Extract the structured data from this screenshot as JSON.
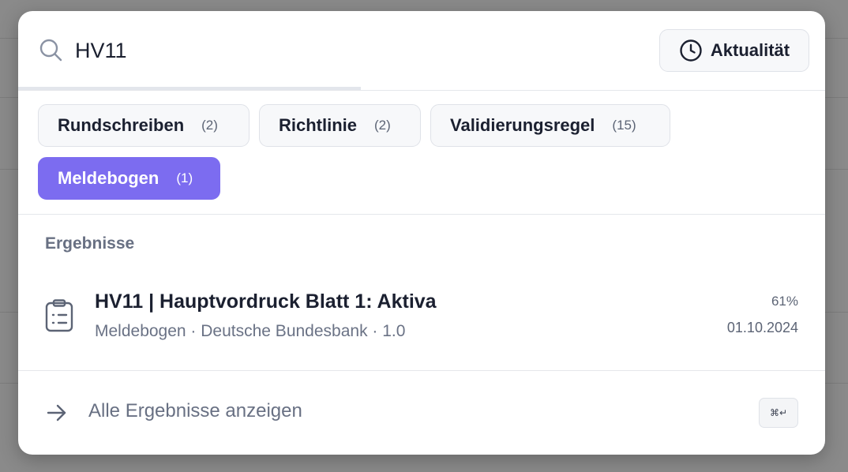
{
  "search": {
    "query": "HV11",
    "placeholder": "",
    "progress": 0.425
  },
  "sort_button": {
    "label": "Aktualität",
    "icon": "clock-icon"
  },
  "filters": [
    {
      "label": "Rundschreiben",
      "count": "(2)",
      "active": false
    },
    {
      "label": "Richtlinie",
      "count": "(2)",
      "active": false
    },
    {
      "label": "Validierungsregel",
      "count": "(15)",
      "active": false
    },
    {
      "label": "Meldebogen",
      "count": "(1)",
      "active": true
    }
  ],
  "results": {
    "section_label": "Ergebnisse",
    "items": [
      {
        "title": "HV11 | Hauptvordruck Blatt 1: Aktiva",
        "meta": "Meldebogen · Deutsche Bundesbank · 1.0",
        "score": "61%",
        "date": "01.10.2024",
        "icon": "clipboard-list-icon"
      }
    ]
  },
  "footer": {
    "label": "Alle Ergebnisse anzeigen",
    "shortcut": "⌘↵",
    "icon": "arrow-right-icon"
  },
  "colors": {
    "accent": "#7c6cf0",
    "text": "#1b2030",
    "muted": "#687083"
  }
}
